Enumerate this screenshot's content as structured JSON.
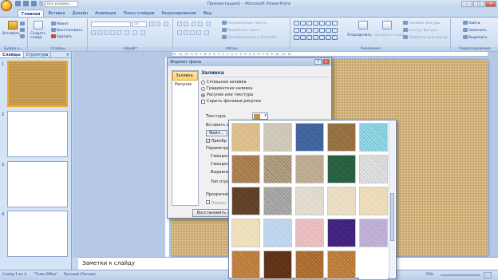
{
  "titlebar": {
    "title": "Презентация1 - Microsoft PowerPoint",
    "format_box": "Без инвамы..."
  },
  "tabs": [
    "Главная",
    "Вставка",
    "Дизайн",
    "Анимация",
    "Показ слайдов",
    "Рецензирование",
    "Вид"
  ],
  "ribbon": {
    "clipboard": {
      "label": "Буфер о...",
      "paste": "Вставить"
    },
    "slides": {
      "label": "Слайды",
      "new_slide": "Создать слайд",
      "layout": "Макет",
      "reset": "Восстановить",
      "delete": "Удалить"
    },
    "font": {
      "label": "Шрифт",
      "size": "18"
    },
    "paragraph": {
      "label": "Абзац",
      "direction": "Направление текста",
      "align": "Выровнять текст",
      "smartart": "Преобразовать в SmartArt"
    },
    "drawing": {
      "label": "Рисование",
      "arrange": "Упорядочить",
      "quick_styles": "Экспресс-стили",
      "fill": "Заливка фигуры",
      "outline": "Контур фигуры",
      "effects": "Эффекты для фигур"
    },
    "editing": {
      "label": "Редактирование",
      "find": "Найти",
      "replace": "Заменить",
      "select": "Выделить"
    }
  },
  "left_pane": {
    "tabs": [
      "Слайды",
      "Структура"
    ],
    "close": "×",
    "slide_numbers": [
      "1",
      "2",
      "3",
      "4"
    ]
  },
  "ruler": "12 · 11 · 10 · 9 · 8 · 7 · 6 · 5 · 4 · 3 · 2 · 1 · 0 · 1 · 2 · 3 · 4 · 5 · 6 · 7 · 8 · 9 · 10 · 11 · 12",
  "dialog": {
    "title": "Формат фона",
    "nav": [
      "Заливка",
      "Рисунок"
    ],
    "heading": "Заливка",
    "options": [
      "Сплошная заливка",
      "Градиентная заливка",
      "Рисунок или текстура",
      "Скрыть фоновые рисунки"
    ],
    "texture_label": "Текстура:",
    "insert_from": "Вставить из:",
    "file_btn": "Файл...",
    "tile": "Преобр",
    "tiling_params": "Параметры",
    "offset_x": "Смещени",
    "offset_y": "Смещени",
    "align": "Выравни",
    "mirror": "Тип отраж",
    "transparency": "Прозрачност",
    "rotate": "Поверн",
    "reset_btn": "Восстановить фон"
  },
  "notes": "Заметки к слайду",
  "statusbar": {
    "slide": "Слайд 1 из 4",
    "theme": "\"Тема Office\"",
    "lang": "Русский (Россия)",
    "zoom": "70%"
  },
  "textures": [
    {
      "name": "papyrus",
      "c1": "#e2c79a",
      "c2": "#cfa96d"
    },
    {
      "name": "canvas",
      "c1": "#d6cfc0",
      "c2": "#bfb6a2"
    },
    {
      "name": "denim",
      "c1": "#4a6fa8",
      "c2": "#2d4d86"
    },
    {
      "name": "woven-mat",
      "c1": "#a07a4a",
      "c2": "#7d5a30"
    },
    {
      "name": "water-droplets",
      "c1": "#9edbe6",
      "c2": "#5fb8cf"
    },
    {
      "name": "paper-bag",
      "c1": "#b58a5a",
      "c2": "#8c6538"
    },
    {
      "name": "fish-fossil",
      "c1": "#b9a68a",
      "c2": "#8f7a5e"
    },
    {
      "name": "sand",
      "c1": "#c6b49c",
      "c2": "#a8957c"
    },
    {
      "name": "green-marble",
      "c1": "#2f6a4a",
      "c2": "#1a4a30"
    },
    {
      "name": "white-marble",
      "c1": "#e6e6e6",
      "c2": "#bfbfbf"
    },
    {
      "name": "brown-marble",
      "c1": "#6a4a30",
      "c2": "#4a301c"
    },
    {
      "name": "granite",
      "c1": "#b0b0b0",
      "c2": "#8a8a8a"
    },
    {
      "name": "newsprint",
      "c1": "#e8e3d8",
      "c2": "#cfc8b8"
    },
    {
      "name": "recycled-paper",
      "c1": "#efe4cf",
      "c2": "#dccca8"
    },
    {
      "name": "parchment",
      "c1": "#f3e4c4",
      "c2": "#e0c99a"
    },
    {
      "name": "stationery",
      "c1": "#f2e6c6",
      "c2": "#e2d0a0"
    },
    {
      "name": "blue-tissue",
      "c1": "#c9dcf2",
      "c2": "#a9c4e6"
    },
    {
      "name": "pink-tissue",
      "c1": "#efc7c9",
      "c2": "#dba6ab"
    },
    {
      "name": "purple-mesh",
      "c1": "#4b2a8a",
      "c2": "#2e166a"
    },
    {
      "name": "bouquet",
      "c1": "#c6b8dc",
      "c2": "#a99cc6"
    },
    {
      "name": "cork",
      "c1": "#c98a4a",
      "c2": "#a5692c"
    },
    {
      "name": "walnut",
      "c1": "#6a3a1a",
      "c2": "#4a2410"
    },
    {
      "name": "oak",
      "c1": "#b87a3a",
      "c2": "#8f5620"
    },
    {
      "name": "medium-wood",
      "c1": "#c88a48",
      "c2": "#a06426"
    },
    {
      "name": "blank",
      "c1": "#ffffff",
      "c2": "#ffffff"
    }
  ]
}
